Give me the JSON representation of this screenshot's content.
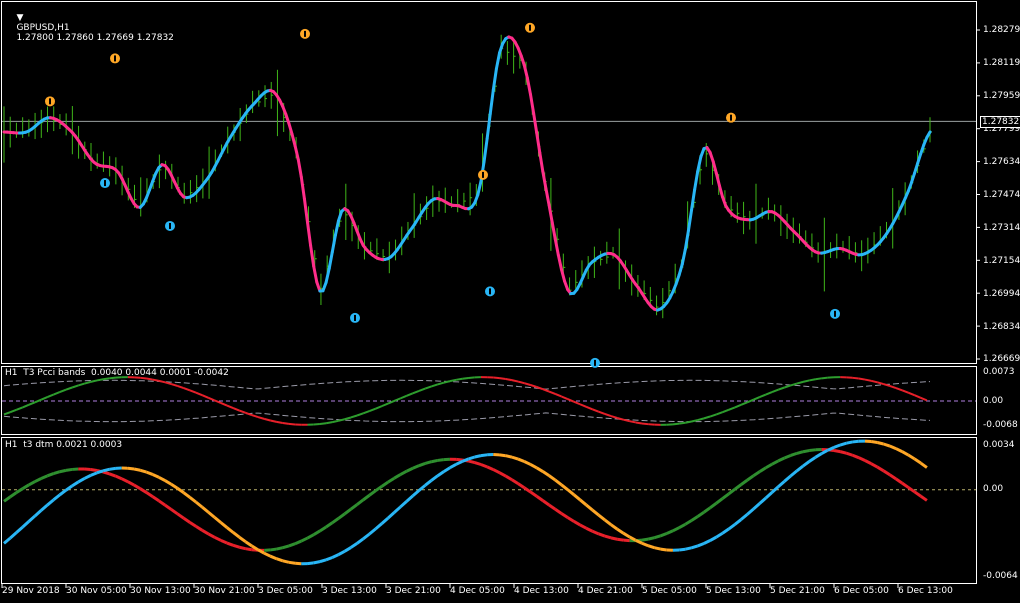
{
  "header": {
    "symbol_label": "GBPUSD,H1",
    "ohlc": "1.27800 1.27860 1.27669 1.27832"
  },
  "price_axis": {
    "ticks": [
      "1.28279",
      "1.28119",
      "1.27959",
      "1.27799",
      "1.27634",
      "1.27474",
      "1.27314",
      "1.27154",
      "1.26994",
      "1.26834",
      "1.26669"
    ],
    "current": "1.27832"
  },
  "ind1": {
    "title": "H1  T3 Pcci bands  0.0040 0.0044 0.0001 -0.0042",
    "ticks": [
      "0.0073",
      "0.00",
      "-0.0068"
    ]
  },
  "ind2": {
    "title": "H1  t3 dtm 0.0021 0.0003",
    "ticks": [
      "0.0034",
      "0.00",
      "-0.0064"
    ]
  },
  "time_axis": [
    "29 Nov 2018",
    "30 Nov 05:00",
    "30 Nov 13:00",
    "30 Nov 21:00",
    "3 Dec 05:00",
    "3 Dec 13:00",
    "3 Dec 21:00",
    "4 Dec 05:00",
    "4 Dec 13:00",
    "4 Dec 21:00",
    "5 Dec 05:00",
    "5 Dec 13:00",
    "5 Dec 21:00",
    "6 Dec 05:00",
    "6 Dec 13:00"
  ],
  "colors": {
    "bars": "#3fb619",
    "t3_up": "#29b6f6",
    "t3_down": "#ff2d8a",
    "pcci_up": "#2e9e2e",
    "pcci_down": "#e8202a",
    "dtm_green": "#2f8f2f",
    "dtm_red": "#e8202a",
    "dtm_blue": "#29b6f6",
    "dtm_orange": "#ffa726",
    "band": "#9a9aa8",
    "mid": "#b07fe0"
  },
  "chart_data": [
    {
      "type": "line",
      "title": "GBPUSD,H1",
      "ylim": [
        1.26669,
        1.28279
      ],
      "x": [
        "29 Nov 2018",
        "30 Nov 05:00",
        "30 Nov 13:00",
        "30 Nov 21:00",
        "3 Dec 05:00",
        "3 Dec 13:00",
        "3 Dec 21:00",
        "4 Dec 05:00",
        "4 Dec 13:00",
        "4 Dec 21:00",
        "5 Dec 05:00",
        "5 Dec 13:00",
        "5 Dec 21:00",
        "6 Dec 05:00",
        "6 Dec 13:00"
      ],
      "series": [
        {
          "values": [
            1.2778,
            1.2778,
            1.2785,
            1.2778,
            1.2763,
            1.2759,
            1.2741,
            1.2762,
            1.2746,
            1.2755,
            1.2775,
            1.2791,
            1.2797,
            1.2766,
            1.27,
            1.274,
            1.2721,
            1.2716,
            1.273,
            1.2745,
            1.2742,
            1.2748,
            1.2819,
            1.2812,
            1.275,
            1.27,
            1.2714,
            1.2718,
            1.2703,
            1.2691,
            1.2712,
            1.277,
            1.2741,
            1.2735,
            1.2739,
            1.2729,
            1.2719,
            1.2721,
            1.2718,
            1.2727,
            1.2748,
            1.2778
          ]
        }
      ],
      "arrows_up": [
        1.2753,
        1.2732,
        1.2687,
        1.27,
        1.2665,
        1.2689
      ],
      "arrows_down": [
        1.2793,
        1.2814,
        1.2826,
        1.2757,
        1.2829,
        1.2785
      ]
    },
    {
      "type": "line",
      "title": "T3 Pcci bands",
      "ylim": [
        -0.0068,
        0.0073
      ],
      "values": [
        0.004,
        0.0044,
        0.0001,
        -0.0042
      ]
    },
    {
      "type": "line",
      "title": "t3 dtm",
      "ylim": [
        -0.0064,
        0.0034
      ],
      "values": [
        0.0021,
        0.0003
      ]
    }
  ]
}
